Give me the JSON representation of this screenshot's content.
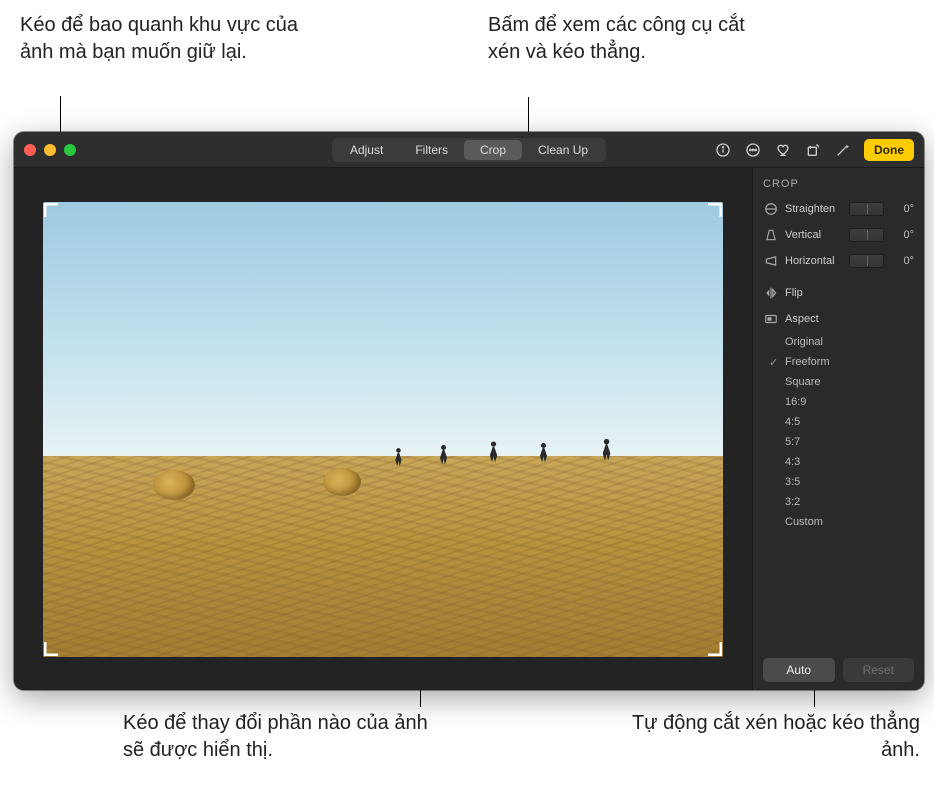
{
  "callouts": {
    "top_left": "Kéo để bao quanh khu vực của ảnh mà bạn muốn giữ lại.",
    "top_right": "Bấm để xem các công cụ cắt xén và kéo thẳng.",
    "bottom_left": "Kéo để thay đổi phần nào của ảnh sẽ được hiển thị.",
    "bottom_right": "Tự động cắt xén hoặc kéo thẳng ảnh."
  },
  "toolbar": {
    "tabs": {
      "adjust": "Adjust",
      "filters": "Filters",
      "crop": "Crop",
      "cleanup": "Clean Up"
    },
    "done": "Done"
  },
  "sidebar": {
    "title": "CROP",
    "straighten": {
      "label": "Straighten",
      "value": "0°"
    },
    "vertical": {
      "label": "Vertical",
      "value": "0°"
    },
    "horizontal": {
      "label": "Horizontal",
      "value": "0°"
    },
    "flip": "Flip",
    "aspect": "Aspect",
    "aspect_items": {
      "original": "Original",
      "freeform": "Freeform",
      "square": "Square",
      "r16_9": "16:9",
      "r4_5": "4:5",
      "r5_7": "5:7",
      "r4_3": "4:3",
      "r3_5": "3:5",
      "r3_2": "3:2",
      "custom": "Custom"
    },
    "auto": "Auto",
    "reset": "Reset"
  }
}
